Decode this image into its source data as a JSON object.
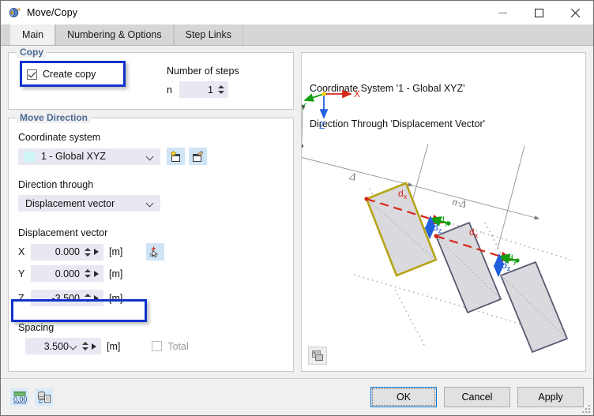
{
  "window": {
    "title": "Move/Copy",
    "icon": "move-copy-icon",
    "minimize_label": "Minimize",
    "maximize_label": "Maximize",
    "close_label": "Close"
  },
  "tabs": [
    {
      "label": "Main",
      "active": true
    },
    {
      "label": "Numbering & Options",
      "active": false
    },
    {
      "label": "Step Links",
      "active": false
    }
  ],
  "copy_group": {
    "title": "Copy",
    "create_copy": {
      "label": "Create copy",
      "checked": true,
      "highlighted": true
    },
    "steps": {
      "label": "Number of steps",
      "symbol": "n",
      "value": "1"
    }
  },
  "move_direction": {
    "title": "Move Direction",
    "coordinate_system": {
      "label": "Coordinate system",
      "value": "1 - Global XYZ",
      "swatch": "#cdf6f6",
      "new_button": "new-coordinate-system-icon",
      "edit_button": "edit-coordinate-system-icon"
    },
    "direction_through": {
      "label": "Direction through",
      "value": "Displacement vector"
    },
    "displacement_vector": {
      "label": "Displacement vector",
      "pick_button": "pick-points-icon",
      "fields": [
        {
          "axis": "X",
          "value": "0.000",
          "unit": "[m]",
          "highlighted": false
        },
        {
          "axis": "Y",
          "value": "0.000",
          "unit": "[m]",
          "highlighted": false
        },
        {
          "axis": "Z",
          "value": "-3.500",
          "unit": "[m]",
          "highlighted": true
        }
      ]
    },
    "spacing": {
      "label": "Spacing",
      "value": "3.500",
      "unit": "[m]",
      "total": {
        "label": "Total",
        "checked": false,
        "disabled": true
      }
    }
  },
  "diagram": {
    "caption_line1": "Coordinate System '1 - Global XYZ'",
    "caption_line2": "Direction Through 'Displacement Vector'",
    "axes": {
      "x": "X",
      "y": "Y",
      "z": "Z"
    },
    "dimensions": {
      "delta": "Δ",
      "n_delta": "n·Δ"
    },
    "vector_labels": {
      "dx": "d",
      "dx_sub": "x",
      "dy": "d",
      "dy_sub": "y",
      "dz": "d",
      "dz_sub": "z"
    },
    "colors": {
      "x_axis": "#d62718",
      "y_axis": "#12a012",
      "z_axis": "#2060dd",
      "selected_shape": "#b8a414",
      "shape_fill": "#d9d9de",
      "shape_stroke": "#5a5a72",
      "dimension_line": "#909090"
    },
    "settings_button": "diagram-settings-icon"
  },
  "footer": {
    "icons": [
      {
        "name": "units-icon",
        "label": "0,00"
      },
      {
        "name": "load-from-library-icon",
        "label": ""
      }
    ],
    "buttons": [
      {
        "label": "OK",
        "default": true
      },
      {
        "label": "Cancel",
        "default": false
      },
      {
        "label": "Apply",
        "default": false
      }
    ]
  }
}
